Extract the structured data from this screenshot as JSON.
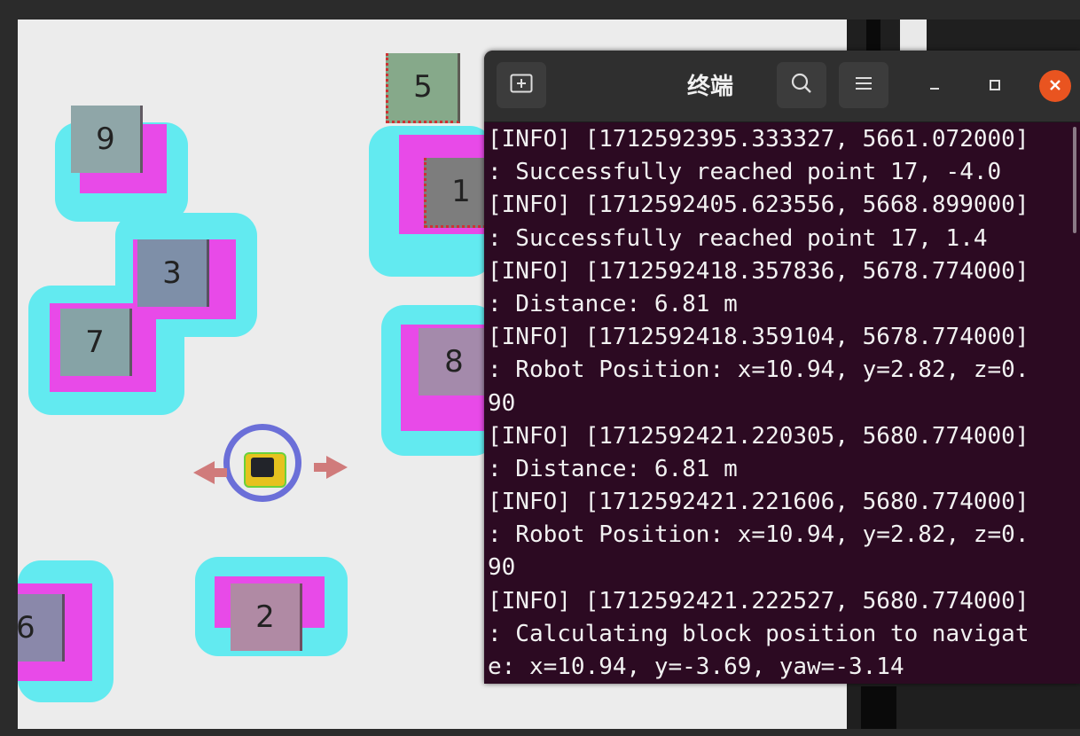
{
  "map": {
    "blocks": [
      {
        "id": "1",
        "label": "1"
      },
      {
        "id": "2",
        "label": "2"
      },
      {
        "id": "3",
        "label": "3"
      },
      {
        "id": "5",
        "label": "5"
      },
      {
        "id": "6",
        "label": "6"
      },
      {
        "id": "7",
        "label": "7"
      },
      {
        "id": "8",
        "label": "8"
      },
      {
        "id": "9",
        "label": "9"
      }
    ]
  },
  "terminal": {
    "title": "终端",
    "lines": [
      "[INFO] [1712592395.333327, 5661.072000]",
      ": Successfully reached point 17, -4.0",
      "[INFO] [1712592405.623556, 5668.899000]",
      ": Successfully reached point 17, 1.4",
      "[INFO] [1712592418.357836, 5678.774000]",
      ": Distance: 6.81 m",
      "[INFO] [1712592418.359104, 5678.774000]",
      ": Robot Position: x=10.94, y=2.82, z=0.",
      "90",
      "[INFO] [1712592421.220305, 5680.774000]",
      ": Distance: 6.81 m",
      "[INFO] [1712592421.221606, 5680.774000]",
      ": Robot Position: x=10.94, y=2.82, z=0.",
      "90",
      "[INFO] [1712592421.222527, 5680.774000]",
      ": Calculating block position to navigat",
      "e: x=10.94, y=-3.69, yaw=-3.14"
    ]
  },
  "colors": {
    "terminal_bg": "#2c0a22",
    "inflation": "#62eaf0",
    "costmap": "#e84ae8",
    "close_button": "#e95420"
  },
  "icons": {
    "new_tab": "new-tab-icon",
    "search": "search-icon",
    "menu": "hamburger-menu-icon",
    "minimize": "minimize-icon",
    "maximize": "maximize-icon",
    "close": "close-icon"
  }
}
